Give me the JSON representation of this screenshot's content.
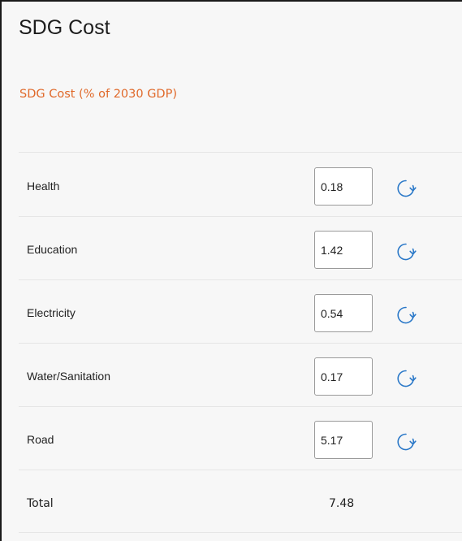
{
  "title": "SDG Cost",
  "subtitle": "SDG Cost (% of 2030 GDP)",
  "rows": [
    {
      "label": "Health",
      "value": "0.18"
    },
    {
      "label": "Education",
      "value": "1.42"
    },
    {
      "label": "Electricity",
      "value": "0.54"
    },
    {
      "label": "Water/Sanitation",
      "value": "0.17"
    },
    {
      "label": "Road",
      "value": "5.17"
    }
  ],
  "total": {
    "label": "Total",
    "value": "7.48"
  },
  "icons": {
    "reset": "refresh-icon"
  },
  "colors": {
    "accent": "#e0692a",
    "icon": "#2a78c8",
    "background": "#f7f7f7"
  }
}
